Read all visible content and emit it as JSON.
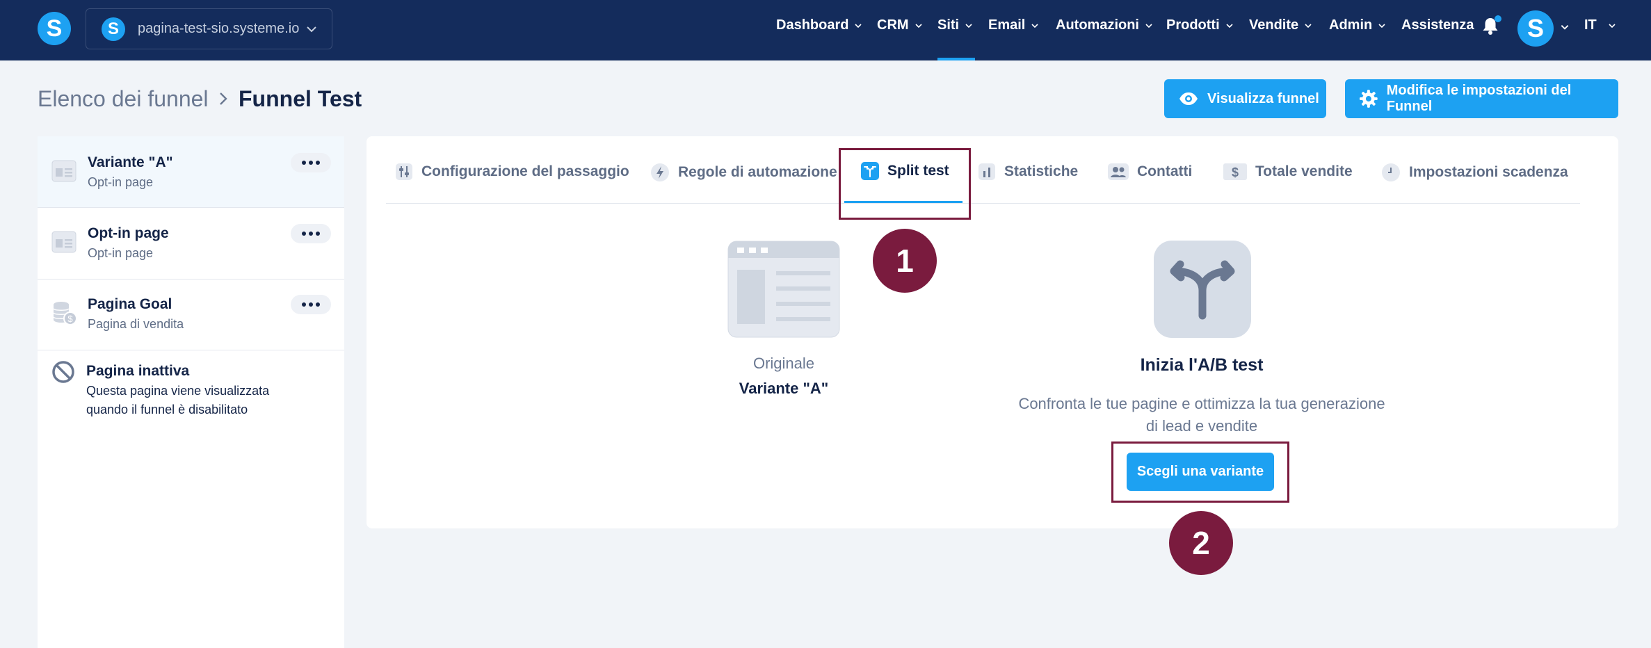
{
  "topnav": {
    "logo_letter": "S",
    "site": {
      "icon_letter": "S",
      "name": "pagina-test-sio.systeme.io"
    },
    "items": [
      {
        "label": "Dashboard",
        "has_dropdown": true
      },
      {
        "label": "CRM",
        "has_dropdown": true
      },
      {
        "label": "Siti",
        "has_dropdown": true,
        "active": true
      },
      {
        "label": "Email",
        "has_dropdown": true
      },
      {
        "label": "Automazioni",
        "has_dropdown": true
      },
      {
        "label": "Prodotti",
        "has_dropdown": true
      },
      {
        "label": "Vendite",
        "has_dropdown": true
      },
      {
        "label": "Admin",
        "has_dropdown": true
      },
      {
        "label": "Assistenza",
        "has_dropdown": false
      }
    ],
    "avatar_letter": "S",
    "language": "IT"
  },
  "breadcrumb": {
    "parent": "Elenco dei funnel",
    "current": "Funnel Test"
  },
  "actions": {
    "view_funnel": "Visualizza funnel",
    "edit_settings": "Modifica le impostazioni del Funnel"
  },
  "sidebar": {
    "pages": [
      {
        "title": "Variante \"A\"",
        "subtitle": "Opt-in page",
        "icon": "page-layout-icon",
        "selected": true
      },
      {
        "title": "Opt-in page",
        "subtitle": "Opt-in page",
        "icon": "page-layout-icon"
      },
      {
        "title": "Pagina Goal",
        "subtitle": "Pagina di vendita",
        "icon": "coins-icon"
      }
    ],
    "inactive": {
      "title": "Pagina inattiva",
      "description_line1": "Questa pagina viene visualizzata",
      "description_line2": "quando il funnel è disabilitato",
      "icon": "prohibited-icon"
    }
  },
  "tabs": [
    {
      "label": "Configurazione del passaggio",
      "icon": "sliders-icon"
    },
    {
      "label": "Regole di automazione",
      "icon": "lightning-icon"
    },
    {
      "label": "Split test",
      "icon": "split-icon",
      "active": true
    },
    {
      "label": "Statistiche",
      "icon": "bar-chart-icon"
    },
    {
      "label": "Contatti",
      "icon": "users-icon"
    },
    {
      "label": "Totale vendite",
      "icon": "dollar-icon"
    },
    {
      "label": "Impostazioni scadenza",
      "icon": "clock-icon"
    }
  ],
  "split_test": {
    "original_label": "Originale",
    "original_variant": "Variante \"A\"",
    "cta_title": "Inizia l'A/B test",
    "cta_desc_line1": "Confronta le tue pagine e ottimizza la tua generazione",
    "cta_desc_line2": "di lead e vendite",
    "cta_button": "Scegli una variante"
  },
  "annotations": {
    "step1": "1",
    "step2": "2"
  },
  "colors": {
    "nav_bg": "#142c5c",
    "accent": "#1da1f2",
    "annotation": "#7a1b3e",
    "page_bg": "#f1f4f8",
    "text_dark": "#142447"
  }
}
